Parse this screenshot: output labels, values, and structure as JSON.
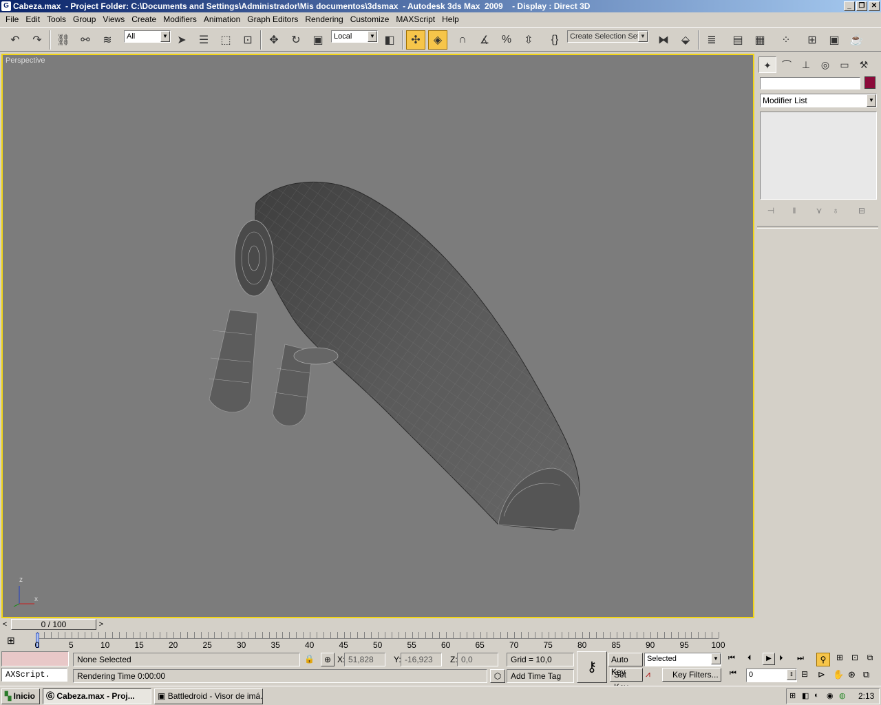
{
  "window": {
    "title_file": "Cabeza.max",
    "title_project": "  - Project Folder: C:\\Documents and Settings\\Administrador\\Mis documentos\\3dsmax",
    "title_app": "  - Autodesk 3ds Max  2009",
    "title_display": "    - Display : Direct 3D",
    "minimize": "_",
    "restore": "❐",
    "close": "✕"
  },
  "menu": [
    "File",
    "Edit",
    "Tools",
    "Group",
    "Views",
    "Create",
    "Modifiers",
    "Animation",
    "Graph Editors",
    "Rendering",
    "Customize",
    "MAXScript",
    "Help"
  ],
  "toolbar": {
    "filter_value": "All",
    "coord_value": "Local",
    "selection_set_placeholder": "Create Selection Set"
  },
  "viewport": {
    "label": "Perspective",
    "axis_z": "z",
    "axis_x": "x"
  },
  "command_panel": {
    "modifier_list": "Modifier List"
  },
  "timeline": {
    "frame_display": "0 / 100",
    "prev": "<",
    "next": ">",
    "tick_labels": [
      "0",
      "5",
      "10",
      "15",
      "20",
      "25",
      "30",
      "35",
      "40",
      "45",
      "50",
      "55",
      "60",
      "65",
      "70",
      "75",
      "80",
      "85",
      "90",
      "95",
      "100"
    ]
  },
  "status": {
    "maxscript_label": "AXScript.",
    "selection_status": "None Selected",
    "rendering_time": "Rendering Time  0:00:00",
    "x_label": "X:",
    "x_value": "51,828",
    "y_label": "Y:",
    "y_value": "-16,923",
    "z_label": "Z:",
    "z_value": "0,0",
    "grid": "Grid = 10,0",
    "add_time_tag": "Add Time Tag",
    "auto_key": "Auto Key",
    "set_key": "Set Key",
    "key_mode_value": "Selected",
    "key_filters": "Key Filters...",
    "current_frame": "0"
  },
  "taskbar": {
    "start": "Inicio",
    "task1": "Cabeza.max     - Proj...",
    "task2": "Battledroid - Visor de imá...",
    "clock": "2:13"
  },
  "colors": {
    "viewport_bg": "#7c7c7c",
    "viewport_border": "#f2d515",
    "active_tool": "#f6c54a",
    "object_color": "#8b0a3a"
  }
}
